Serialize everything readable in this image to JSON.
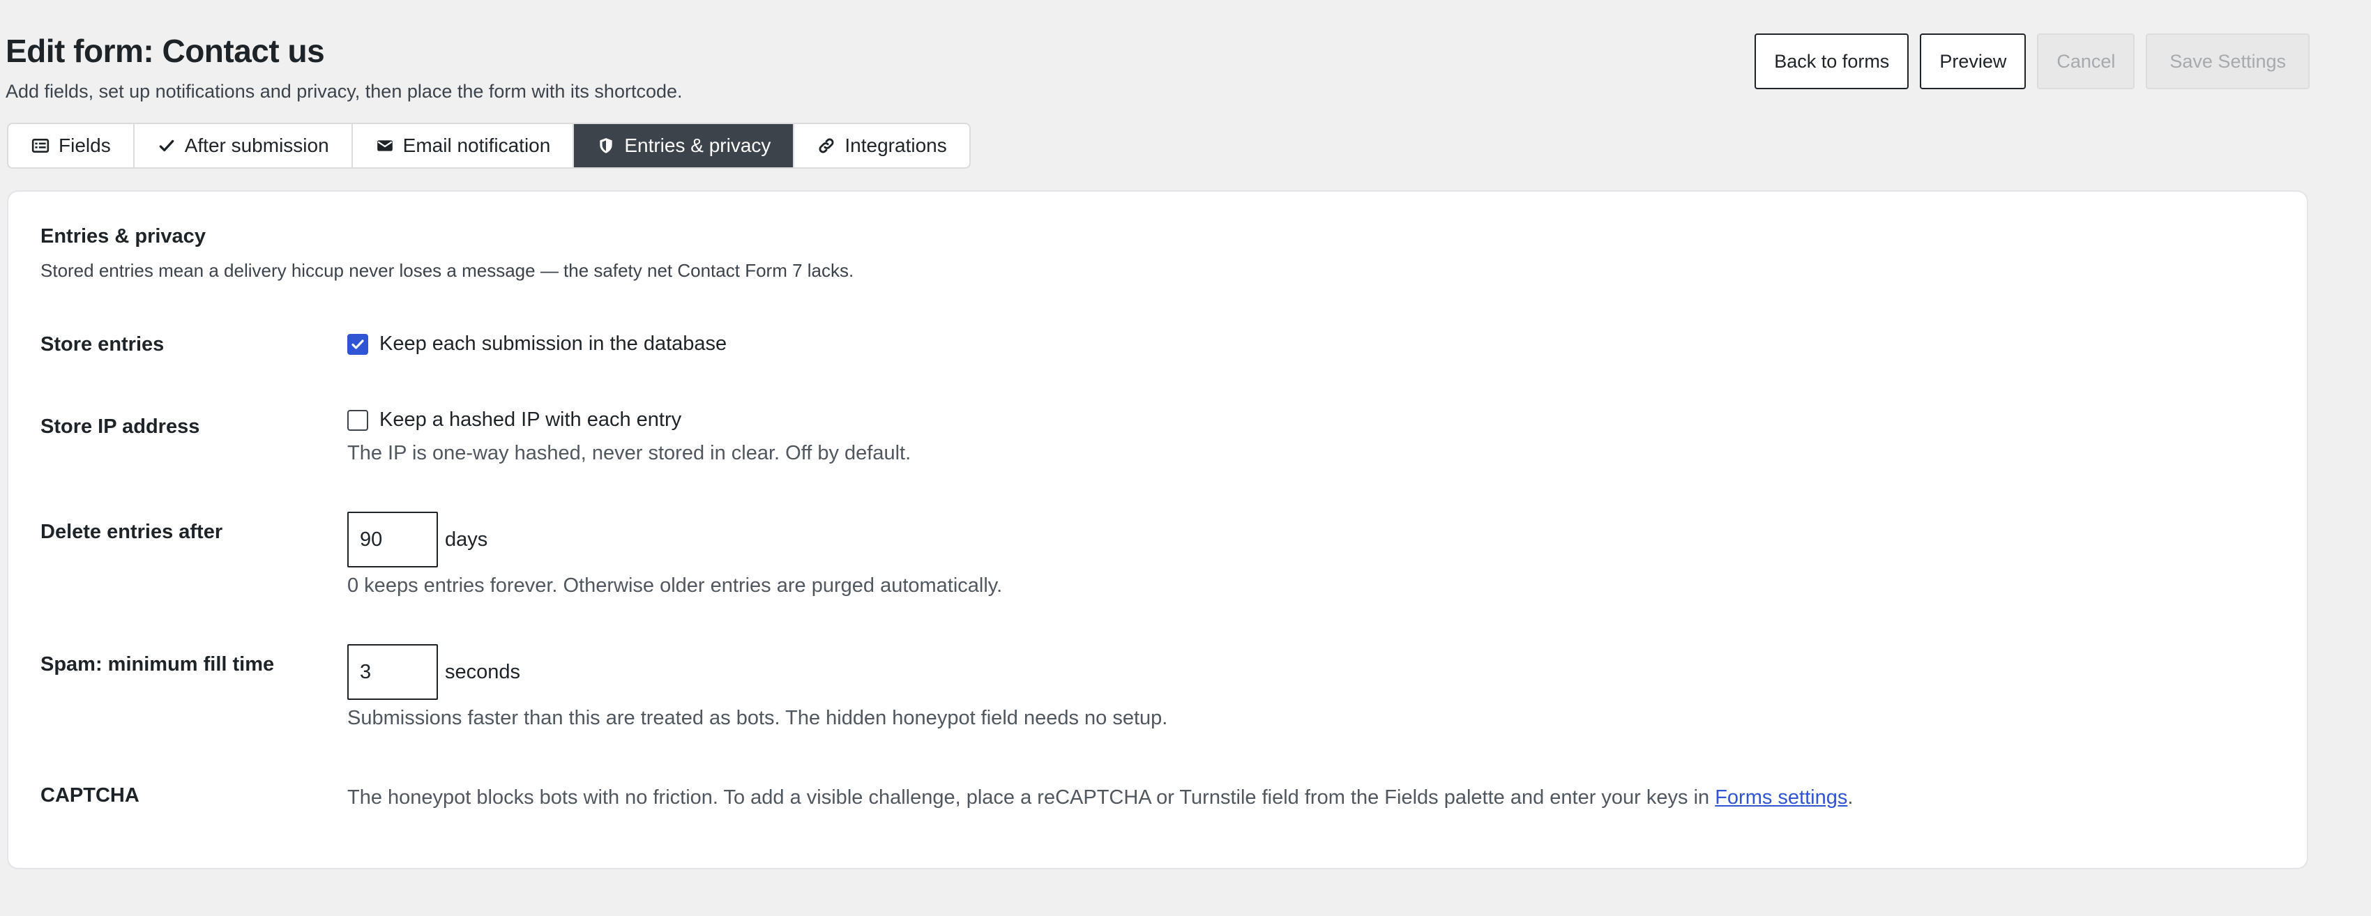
{
  "header": {
    "title": "Edit form: Contact us",
    "subtitle": "Add fields, set up notifications and privacy, then place the form with its shortcode.",
    "buttons": {
      "back": "Back to forms",
      "preview": "Preview",
      "cancel": "Cancel",
      "save": "Save Settings"
    }
  },
  "tabs": [
    {
      "label": "Fields",
      "icon": "list-form-icon"
    },
    {
      "label": "After submission",
      "icon": "checkmark-icon"
    },
    {
      "label": "Email notification",
      "icon": "envelope-icon"
    },
    {
      "label": "Entries & privacy",
      "icon": "shield-icon",
      "active": true
    },
    {
      "label": "Integrations",
      "icon": "link-icon"
    }
  ],
  "section": {
    "title": "Entries & privacy",
    "description": "Stored entries mean a delivery hiccup never loses a message — the safety net Contact Form 7 lacks."
  },
  "settings": {
    "store_entries": {
      "label": "Store entries",
      "checkbox_label": "Keep each submission in the database",
      "checked": true
    },
    "store_ip": {
      "label": "Store IP address",
      "checkbox_label": "Keep a hashed IP with each entry",
      "checked": false,
      "help": "The IP is one-way hashed, never stored in clear. Off by default."
    },
    "delete_after": {
      "label": "Delete entries after",
      "value": "90",
      "unit": "days",
      "help": "0 keeps entries forever. Otherwise older entries are purged automatically."
    },
    "spam_min_time": {
      "label": "Spam: minimum fill time",
      "value": "3",
      "unit": "seconds",
      "help": "Submissions faster than this are treated as bots. The hidden honeypot field needs no setup."
    },
    "captcha": {
      "label": "CAPTCHA",
      "text_before": "The honeypot blocks bots with no friction. To add a visible challenge, place a reCAPTCHA or Turnstile field from the Fields palette and enter your keys in",
      "link_text": "Forms settings",
      "text_after": "."
    }
  },
  "colors": {
    "accent": "#2f55d4",
    "active_tab": "#3c434a",
    "background": "#f0f0f1"
  }
}
